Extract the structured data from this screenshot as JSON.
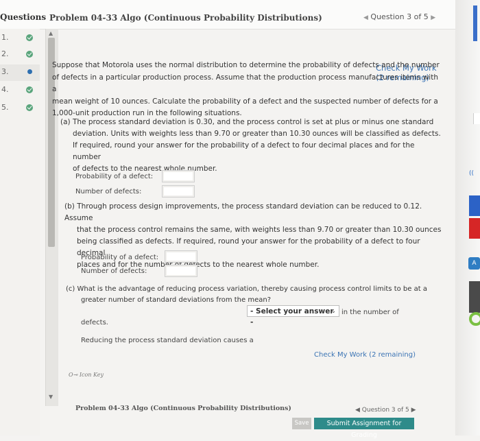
{
  "header": {
    "questions_label": "Questions",
    "problem_title": "Problem 04-33 Algo (Continuous Probability Distributions)",
    "question_nav": "Question 3 of 5"
  },
  "sidebar": {
    "items": [
      {
        "num": "1.",
        "status": "complete"
      },
      {
        "num": "2.",
        "status": "complete"
      },
      {
        "num": "3.",
        "status": "current"
      },
      {
        "num": "4.",
        "status": "complete"
      },
      {
        "num": "5.",
        "status": "complete"
      }
    ]
  },
  "main": {
    "check_work_top": "Check My Work (2 remaining)",
    "intro": [
      "Suppose that Motorola uses the normal distribution to determine the probability of defects and the number",
      "of defects in a particular production process. Assume that the production process manufactures items with a",
      "mean weight of 10 ounces. Calculate the probability of a defect and the suspected number of defects for a",
      "1,000-unit production run in the following situations."
    ],
    "part_a": {
      "text": [
        "(a) The process standard deviation is 0.30, and the process control is set at plus or minus one standard",
        "deviation. Units with weights less than 9.70 or greater than 10.30 ounces will be classified as defects.",
        "If required, round your answer for the probability of a defect to four decimal places and for the number",
        "of defects to the nearest whole number."
      ],
      "prob_label": "Probability of a defect:",
      "num_label": "Number of defects:",
      "prob_value": "",
      "num_value": ""
    },
    "part_b": {
      "text": [
        "(b) Through process design improvements, the process standard deviation can be reduced to 0.12. Assume",
        "that the process control remains the same, with weights less than 9.70 or greater than 10.30 ounces",
        "being classified as defects. If required, round your answer for the probability of a defect to four decimal",
        "places and for the number of defects to the nearest whole number."
      ],
      "prob_label": "Probability of a defect:",
      "num_label": "Number of defects:",
      "prob_value": "",
      "num_value": ""
    },
    "part_c": {
      "text": [
        "(c) What is the advantage of reducing process variation, thereby causing process control limits to be at a",
        "greater number of standard deviations from the mean?"
      ],
      "sentence_start": "Reducing the process standard deviation causes a",
      "select_value": "- Select your answer -",
      "sentence_end": "in the number of",
      "sentence_end2": "defects."
    },
    "check_work_bottom": "Check My Work (2 remaining)",
    "icon_key": "Icon Key"
  },
  "footer": {
    "problem_title": "Problem 04-33 Algo (Continuous Probability Distributions)",
    "question_nav": "Question 3 of 5",
    "save_label": "Save",
    "submit_label": "Submit Assignment for Grading"
  }
}
